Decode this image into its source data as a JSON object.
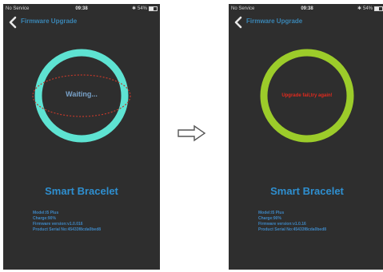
{
  "status_bar": {
    "carrier": "No Service",
    "time": "09:38",
    "battery": "54%",
    "battery_level": 0.54
  },
  "nav": {
    "title": "Firmware Upgrade"
  },
  "left_screen": {
    "status_text": "Waiting...",
    "ring_color": "#5ee3d2",
    "ellipse_color": "#c0392b",
    "device_name": "Smart Bracelet",
    "info": {
      "model": "Model:I5 Plus",
      "charge": "Charge:90%",
      "firmware": "Firmware version:v1.0.016",
      "serial": "Product Serial No:45433f8cda0bed8"
    }
  },
  "right_screen": {
    "status_text": "Upgrade fail,try again!",
    "ring_color": "#9ccc2a",
    "device_name": "Smart Bracelet",
    "info": {
      "model": "Model:I5 Plus",
      "charge": "Charge:90%",
      "firmware": "Firmware version:v1.0.16",
      "serial": "Product Serial No:45433f8cda0bed8"
    }
  },
  "colors": {
    "phone_bg": "#2e2e2e",
    "accent_blue": "#2e8fd0",
    "nav_blue": "#3a86b5",
    "error_red": "#e12a1e"
  }
}
